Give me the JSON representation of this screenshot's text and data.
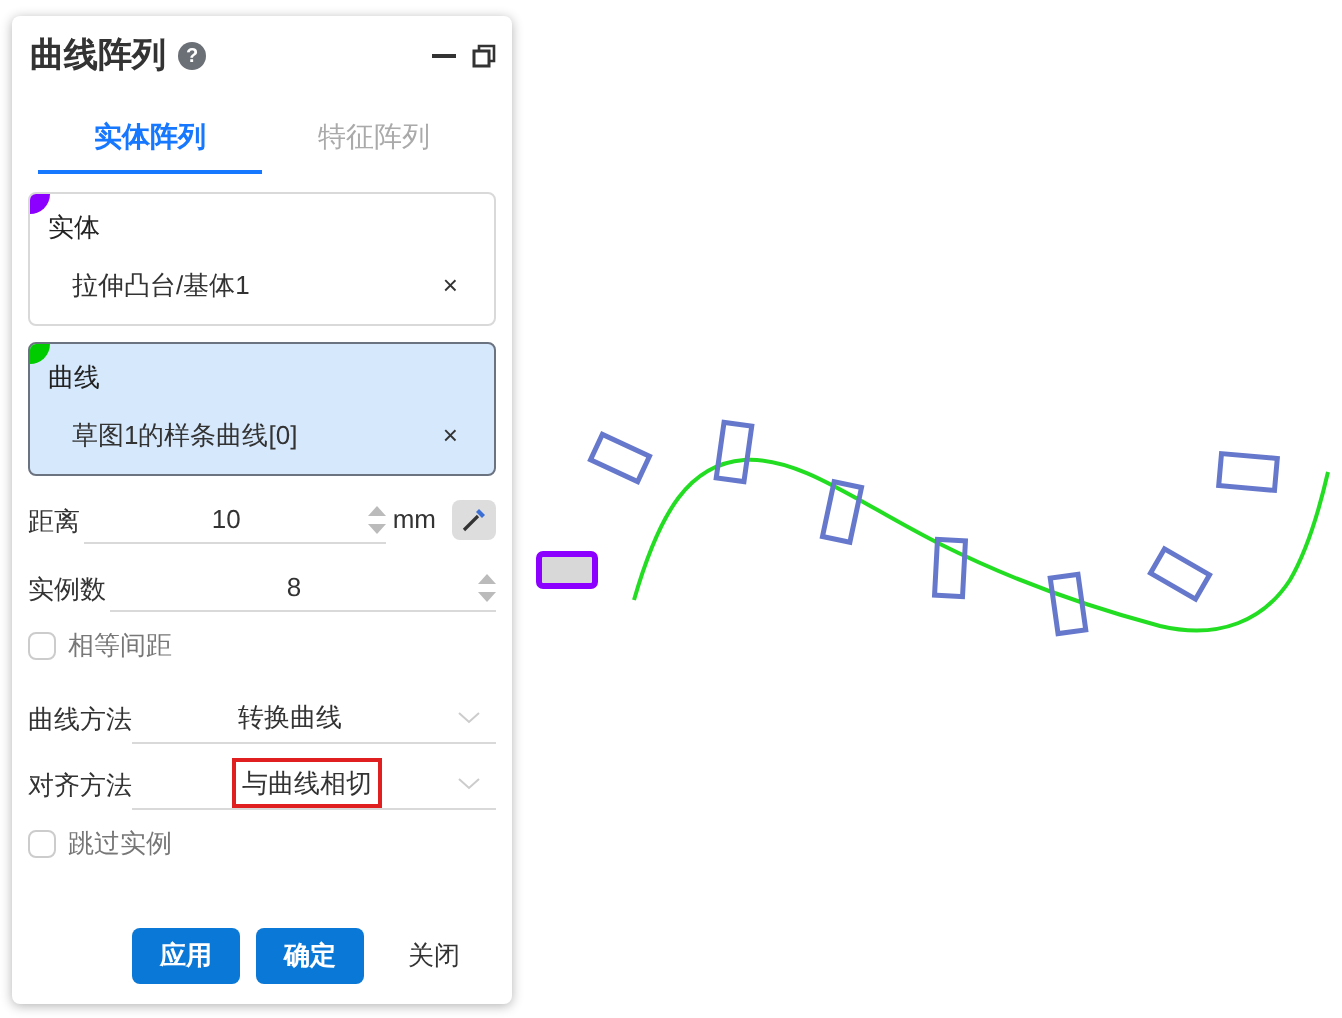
{
  "panel": {
    "title": "曲线阵列",
    "help": "?"
  },
  "tabs": [
    {
      "label": "实体阵列",
      "selected": true
    },
    {
      "label": "特征阵列",
      "selected": false
    }
  ],
  "selection_boxes": [
    {
      "label": "实体",
      "value": "拉伸凸台/基体1",
      "remove": "×",
      "color": "#8b00ff",
      "active": false
    },
    {
      "label": "曲线",
      "value": "草图1的样条曲线[0]",
      "remove": "×",
      "color": "#00cc00",
      "active": true
    }
  ],
  "fields": [
    {
      "kind": "spin",
      "label": "距离",
      "value": "10",
      "unit": "mm"
    },
    {
      "kind": "spin",
      "label": "实例数",
      "value": "8"
    },
    {
      "kind": "checkbox",
      "label": "相等间距",
      "checked": false
    },
    {
      "kind": "select",
      "label": "曲线方法",
      "value": "转换曲线",
      "highlighted": false
    },
    {
      "kind": "select",
      "label": "对齐方法",
      "value": "与曲线相切",
      "highlighted": true
    },
    {
      "kind": "checkbox",
      "label": "跳过实例",
      "checked": false
    }
  ],
  "buttons": [
    {
      "label": "应用",
      "primary": true
    },
    {
      "label": "确定",
      "primary": true
    },
    {
      "label": "关闭",
      "primary": false
    }
  ]
}
